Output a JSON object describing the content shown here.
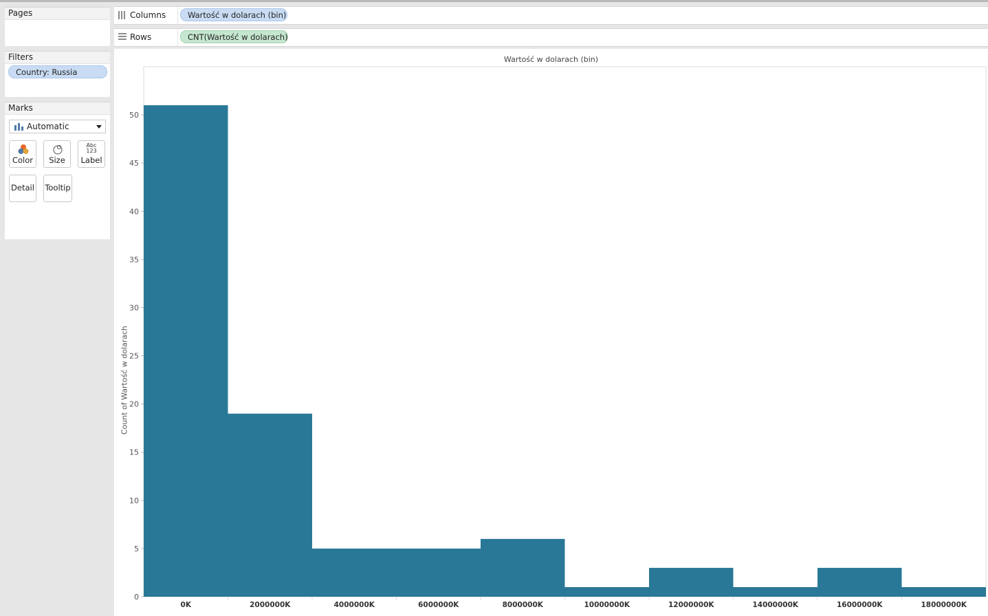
{
  "panels": {
    "pages": {
      "title": "Pages"
    },
    "filters": {
      "title": "Filters",
      "items": [
        "Country: Russia"
      ]
    },
    "marks": {
      "title": "Marks",
      "type": "Automatic",
      "buttons": [
        "Color",
        "Size",
        "Label",
        "Detail",
        "Tooltip"
      ],
      "label_icon_text": [
        "Abc",
        "123"
      ]
    }
  },
  "shelves": {
    "columns": {
      "label": "Columns",
      "pill": "Wartość w dolarach (bin)"
    },
    "rows": {
      "label": "Rows",
      "pill": "CNT(Wartość w dolarach)"
    }
  },
  "colors": {
    "bar": "#2a7897",
    "pill_blue": "#c9dcf3",
    "pill_green": "#c5e6cf"
  },
  "chart_data": {
    "type": "bar",
    "title": "Wartość w dolarach (bin)",
    "xlabel": "",
    "ylabel": "Count of Wartość w dolarach",
    "categories": [
      "0K",
      "2000000K",
      "4000000K",
      "6000000K",
      "8000000K",
      "10000000K",
      "12000000K",
      "14000000K",
      "16000000K",
      "18000000K"
    ],
    "values": [
      51,
      19,
      5,
      5,
      6,
      1,
      3,
      1,
      3,
      1
    ],
    "yticks": [
      0,
      5,
      10,
      15,
      20,
      25,
      30,
      35,
      40,
      45,
      50
    ],
    "ylim": [
      0,
      55
    ],
    "grid": false
  }
}
